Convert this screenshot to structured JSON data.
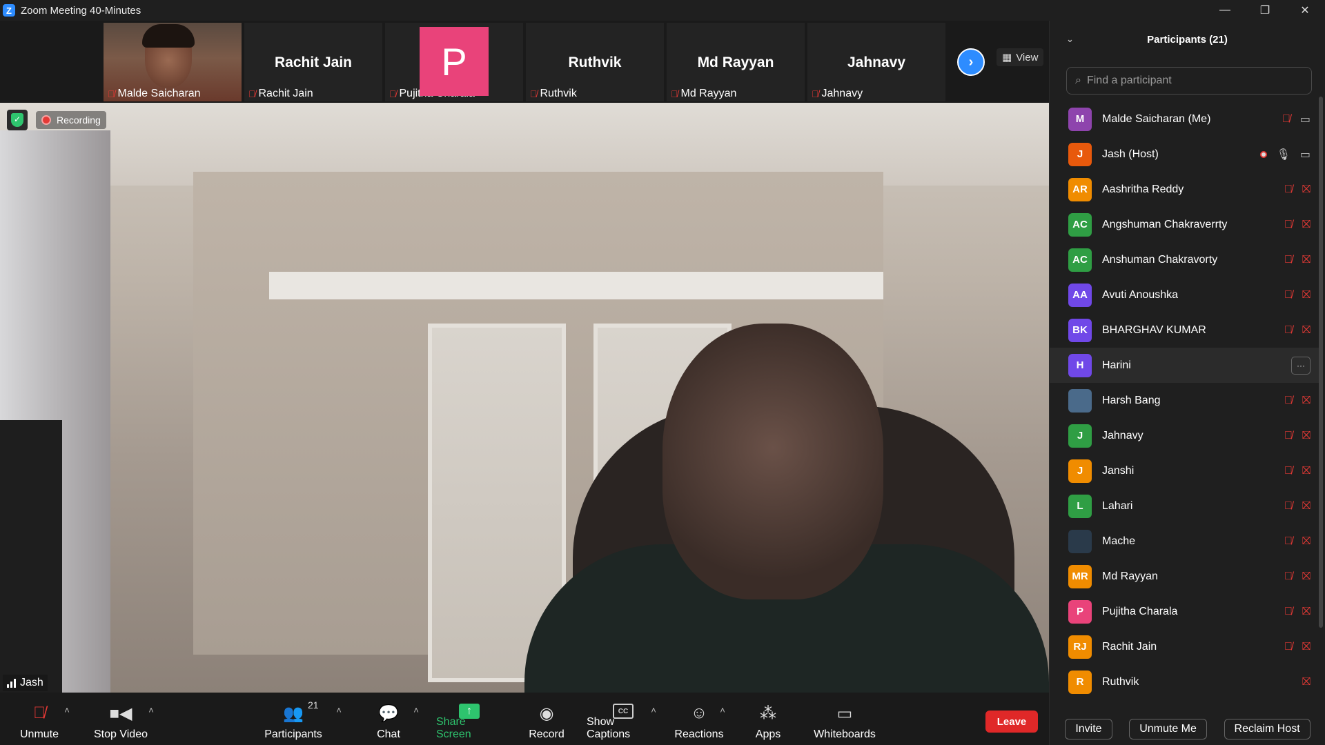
{
  "window": {
    "title": "Zoom Meeting 40-Minutes",
    "logo": "Z"
  },
  "gallery": {
    "tiles": [
      {
        "caption": "Malde Saicharan",
        "big_name": ""
      },
      {
        "caption": "Rachit Jain",
        "big_name": "Rachit Jain"
      },
      {
        "caption": "Pujitha Charala",
        "big_name": "P"
      },
      {
        "caption": "Ruthvik",
        "big_name": "Ruthvik"
      },
      {
        "caption": "Md Rayyan",
        "big_name": "Md Rayyan"
      },
      {
        "caption": "Jahnavy",
        "big_name": "Jahnavy"
      }
    ],
    "view_label": "View"
  },
  "main_video": {
    "recording_label": "Recording",
    "speaker_name": "Jash"
  },
  "toolbar": {
    "unmute": "Unmute",
    "stop_video": "Stop Video",
    "participants": "Participants",
    "participants_count": "21",
    "chat": "Chat",
    "share_screen": "Share Screen",
    "record": "Record",
    "show_captions": "Show Captions",
    "captions_icon_text": "CC",
    "reactions": "Reactions",
    "apps": "Apps",
    "whiteboards": "Whiteboards",
    "leave": "Leave"
  },
  "panel": {
    "title": "Participants (21)",
    "search_placeholder": "Find a participant",
    "participants": [
      {
        "initials": "M",
        "name": "Malde Saicharan (Me)",
        "color": "#8e44ad",
        "mic": "muted",
        "cam": "on"
      },
      {
        "initials": "J",
        "name": "Jash (Host)",
        "color": "#e8590c",
        "mic": "on",
        "cam": "on",
        "recording": true
      },
      {
        "initials": "AR",
        "name": "Aashritha Reddy",
        "color": "#f08c00",
        "mic": "muted",
        "cam": "off"
      },
      {
        "initials": "AC",
        "name": "Angshuman Chakraverrty",
        "color": "#2f9e44",
        "mic": "muted",
        "cam": "off"
      },
      {
        "initials": "AC",
        "name": "Anshuman Chakravorty",
        "color": "#2f9e44",
        "mic": "muted",
        "cam": "off"
      },
      {
        "initials": "AA",
        "name": "Avuti Anoushka",
        "color": "#7048e8",
        "mic": "muted",
        "cam": "off"
      },
      {
        "initials": "BK",
        "name": "BHARGHAV KUMAR",
        "color": "#7048e8",
        "mic": "muted",
        "cam": "off"
      },
      {
        "initials": "H",
        "name": "Harini",
        "color": "#7048e8",
        "mic": "none",
        "cam": "none",
        "hover": true
      },
      {
        "initials": "",
        "name": "Harsh Bang",
        "color": "#4a6a8a",
        "mic": "muted",
        "cam": "off",
        "photo": true
      },
      {
        "initials": "J",
        "name": "Jahnavy",
        "color": "#2f9e44",
        "mic": "muted",
        "cam": "off"
      },
      {
        "initials": "J",
        "name": "Janshi",
        "color": "#f08c00",
        "mic": "muted",
        "cam": "off"
      },
      {
        "initials": "L",
        "name": "Lahari",
        "color": "#2f9e44",
        "mic": "muted",
        "cam": "off"
      },
      {
        "initials": "",
        "name": "Mache",
        "color": "#2a3a4a",
        "mic": "muted",
        "cam": "off",
        "photo": true
      },
      {
        "initials": "MR",
        "name": "Md Rayyan",
        "color": "#f08c00",
        "mic": "muted",
        "cam": "off"
      },
      {
        "initials": "P",
        "name": "Pujitha Charala",
        "color": "#e9437a",
        "mic": "muted",
        "cam": "off"
      },
      {
        "initials": "RJ",
        "name": "Rachit Jain",
        "color": "#f08c00",
        "mic": "muted",
        "cam": "off"
      },
      {
        "initials": "R",
        "name": "Ruthvik",
        "color": "#f08c00",
        "mic": "none",
        "cam": "off"
      }
    ],
    "invite": "Invite",
    "unmute_me": "Unmute Me",
    "reclaim_host": "Reclaim Host"
  }
}
